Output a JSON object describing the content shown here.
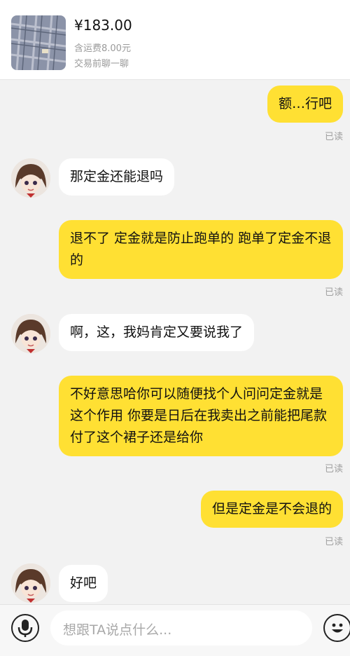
{
  "product": {
    "price": "¥183.00",
    "shipping": "含运费8.00元",
    "trade_note": "交易前聊一聊"
  },
  "messages": [
    {
      "side": "me",
      "text": "额…行吧",
      "status": "已读"
    },
    {
      "side": "them",
      "text": "那定金还能退吗"
    },
    {
      "side": "me",
      "text": "退不了 定金就是防止跑单的 跑单了定金不退的",
      "status": "已读"
    },
    {
      "side": "them",
      "text": "啊，这，我妈肯定又要说我了"
    },
    {
      "side": "me",
      "text": "不好意思哈你可以随便找个人问问定金就是这个作用 你要是日后在我卖出之前能把尾款付了这个裙子还是给你",
      "status": "已读"
    },
    {
      "side": "me",
      "text": "但是定金是不会退的",
      "status": "已读"
    },
    {
      "side": "them",
      "text": "好吧"
    }
  ],
  "input": {
    "placeholder": "想跟TA说点什么..."
  },
  "icons": {
    "voice": "microphone-icon",
    "emoji": "emoji-icon"
  },
  "colors": {
    "my_bubble": "#ffe033",
    "their_bubble": "#ffffff",
    "background": "#f2f2f2"
  }
}
